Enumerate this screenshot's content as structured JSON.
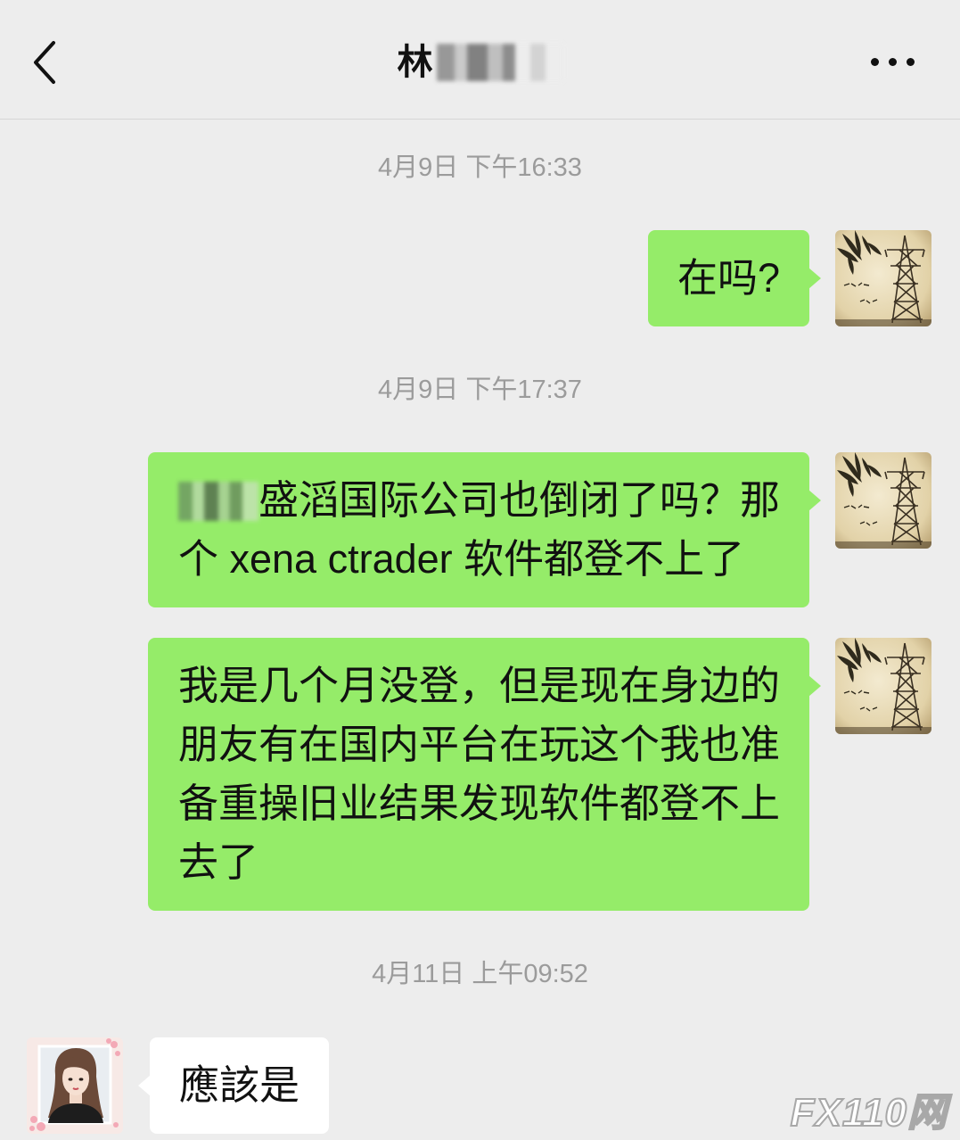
{
  "header": {
    "title": "林"
  },
  "icons": {
    "back": "chevron-left-icon",
    "more": "more-dots-icon",
    "self_avatar": "bamboo-pylon-avatar",
    "contact_avatar": "girl-portrait-avatar"
  },
  "chat": {
    "timestamps": [
      "4月9日 下午16:33",
      "4月9日 下午17:37",
      "4月11日 上午09:52"
    ],
    "outgoing": [
      "在吗?",
      "盛滔国际公司也倒闭了吗？那个 xena ctrader 软件都登不上了",
      "我是几个月没登，但是现在身边的朋友有在国内平台在玩这个我也准备重操旧业结果发现软件都登不上去了"
    ],
    "incoming": [
      "應該是"
    ]
  },
  "watermark": {
    "text": "FX110网"
  },
  "colors": {
    "background": "#ededed",
    "outgoing_bubble": "#95ec69",
    "incoming_bubble": "#ffffff",
    "timestamp_text": "#9b9b9b",
    "text": "#111111"
  }
}
